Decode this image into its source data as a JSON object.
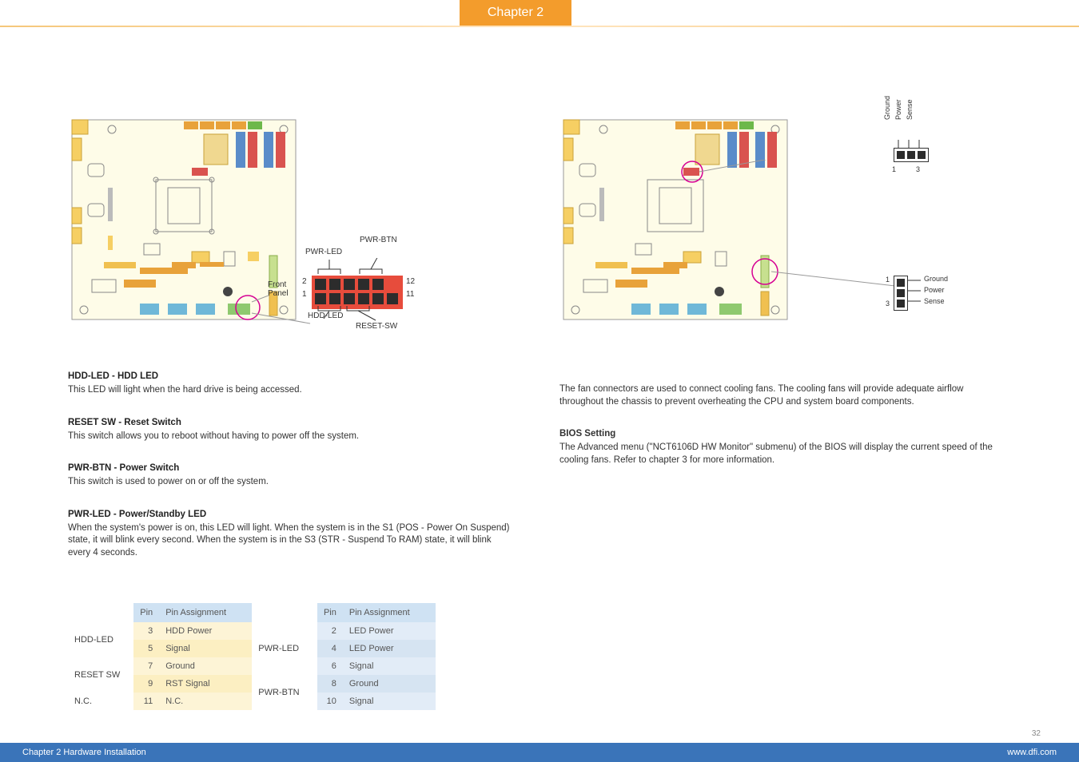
{
  "header": {
    "chapter": "Chapter 2"
  },
  "left": {
    "board_caption_a": "Front\nPanel",
    "fp_labels": {
      "pwr_btn": "PWR-BTN",
      "pwr_led": "PWR-LED",
      "reset_sw": "RESET-SW",
      "hdd_led": "HDD-LED",
      "pin_2": "2",
      "pin_1": "1",
      "pin_12": "12",
      "pin_11": "11"
    },
    "hdd_led_h": "HDD-LED - HDD LED",
    "hdd_led_p": "This LED will light when the hard drive is being accessed.",
    "reset_h": "RESET SW - Reset Switch",
    "reset_p": "This switch allows you to reboot without having to power off the system.",
    "pwr_btn_h": "PWR-BTN - Power Switch",
    "pwr_btn_p": "This switch is used to power on or off the system.",
    "pwr_led_h": "PWR-LED - Power/Standby LED",
    "pwr_led_p": "When the system's power is on, this LED will light. When the system is in the S1 (POS - Power On Suspend) state, it will blink every second. When the system is in the S3 (STR - Suspend To RAM) state, it will blink every 4 seconds.",
    "table": {
      "headers": {
        "pin": "Pin",
        "assign": "Pin Assignment",
        "pin2": "Pin",
        "assign2": "Pin Assignment"
      },
      "rows": [
        {
          "func_a": "HDD-LED",
          "pin_a": "3",
          "asg_a": "HDD Power",
          "func_b": "PWR-LED",
          "pin_b": "2",
          "asg_b": "LED Power",
          "rs_a": 2,
          "rs_b": 3
        },
        {
          "func_a": "",
          "pin_a": "5",
          "asg_a": "Signal",
          "func_b": "",
          "pin_b": "4",
          "asg_b": "LED Power"
        },
        {
          "func_a": "RESET SW",
          "pin_a": "7",
          "asg_a": "Ground",
          "func_b": "",
          "pin_b": "6",
          "asg_b": "Signal",
          "rs_a": 2
        },
        {
          "func_a": "",
          "pin_a": "9",
          "asg_a": "RST Signal",
          "func_b": "PWR-BTN",
          "pin_b": "8",
          "asg_b": "Ground",
          "rs_b": 2
        },
        {
          "func_a": "N.C.",
          "pin_a": "11",
          "asg_a": "N.C.",
          "func_b": "",
          "pin_b": "10",
          "asg_b": "Signal",
          "rs_a": 1
        }
      ]
    }
  },
  "right": {
    "fan1": {
      "pins": [
        "Ground",
        "Power",
        "Sense"
      ],
      "n1": "1",
      "n3": "3"
    },
    "fan2": {
      "pins": [
        "Ground",
        "Power",
        "Sense"
      ],
      "n1": "1",
      "n3": "3"
    },
    "p1": "The fan connectors are used to connect cooling fans. The cooling fans will provide adequate airflow throughout the chassis to prevent overheating the CPU and system board components.",
    "bios_h": "BIOS Setting",
    "bios_p": "The Advanced menu (\"NCT6106D HW Monitor\" submenu) of the BIOS will display the current speed of the cooling fans. Refer to chapter 3 for more information."
  },
  "footer": {
    "left": "Chapter 2 Hardware Installation",
    "right": "www.dfi.com",
    "page": "32"
  }
}
